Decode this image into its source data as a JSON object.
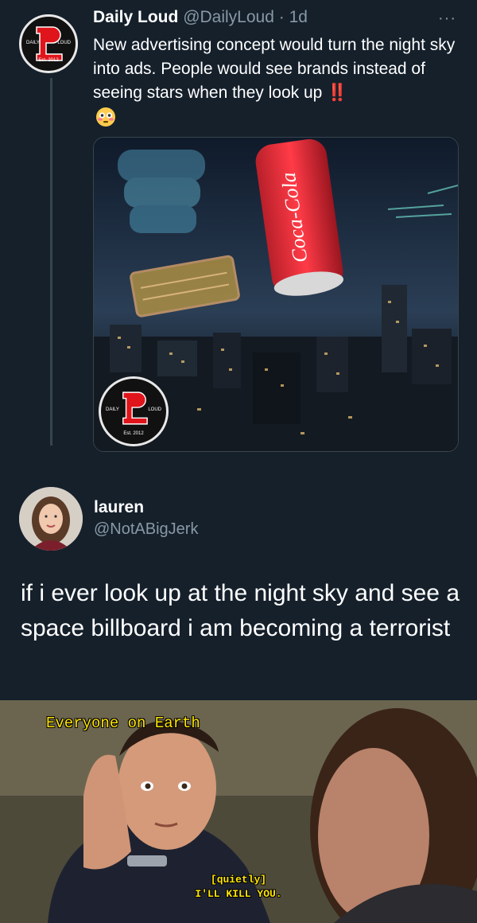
{
  "tweet": {
    "author_name": "Daily Loud",
    "author_handle": "@DailyLoud",
    "time": "· 1d",
    "more": "···",
    "text": "New advertising concept would turn the night sky into ads. People would see brands instead of seeing stars when they look up",
    "exclamation": "‼️",
    "emoji": "😳",
    "logo_text": {
      "left": "DAILY",
      "right": "LOUD",
      "est": "Est. 2012"
    },
    "media_logo_text": {
      "left": "DAILY",
      "right": "LOUD",
      "est": "Est. 2012"
    },
    "media_brand": "Coca-Cola"
  },
  "reply": {
    "author_name": "lauren",
    "author_handle": "@NotABigJerk",
    "text": "if i ever look up at the night sky and see a space billboard i am becoming a terrorist"
  },
  "meme": {
    "caption": "Everyone on Earth",
    "subtitle_line1": "[quietly]",
    "subtitle_line2": "I'LL KILL YOU."
  },
  "colors": {
    "background": "#15202b",
    "muted": "#8899a6",
    "caption": "#ffe600"
  }
}
